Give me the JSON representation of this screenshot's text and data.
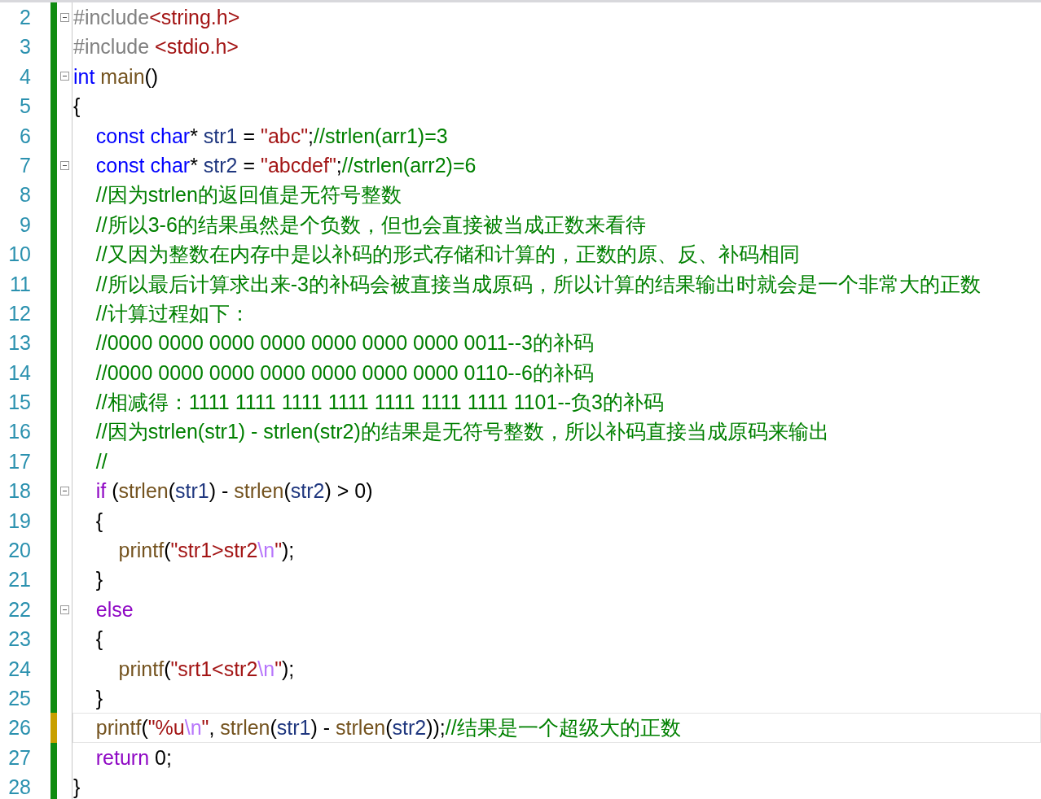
{
  "editor": {
    "lines": [
      {
        "number": "2",
        "modified": false,
        "fold_marker": true,
        "current": false,
        "tokens": [
          {
            "kind": "preproc",
            "text": "#include"
          },
          {
            "kind": "string",
            "text": "<string.h>"
          }
        ]
      },
      {
        "number": "3",
        "modified": false,
        "fold_marker": false,
        "current": false,
        "tokens": [
          {
            "kind": "preproc",
            "text": "#include"
          },
          {
            "kind": "string",
            "text": " <stdio.h>"
          }
        ]
      },
      {
        "number": "4",
        "modified": false,
        "fold_marker": true,
        "current": false,
        "tokens": [
          {
            "kind": "keyword",
            "text": "int"
          },
          {
            "kind": "function",
            "text": " main"
          },
          {
            "kind": "plain",
            "text": "()"
          }
        ]
      },
      {
        "number": "5",
        "modified": false,
        "fold_marker": false,
        "current": false,
        "tokens": [
          {
            "kind": "plain",
            "text": "{"
          }
        ]
      },
      {
        "number": "6",
        "modified": false,
        "fold_marker": false,
        "current": false,
        "tokens": [
          {
            "kind": "keyword",
            "text": "    const"
          },
          {
            "kind": "keyword",
            "text": " char"
          },
          {
            "kind": "plain",
            "text": "* "
          },
          {
            "kind": "variable",
            "text": "str1"
          },
          {
            "kind": "plain",
            "text": " = "
          },
          {
            "kind": "string",
            "text": "\"abc\""
          },
          {
            "kind": "plain",
            "text": ";"
          },
          {
            "kind": "comment",
            "text": "//strlen(arr1)=3"
          }
        ]
      },
      {
        "number": "7",
        "modified": false,
        "fold_marker": true,
        "current": false,
        "tokens": [
          {
            "kind": "keyword",
            "text": "    const"
          },
          {
            "kind": "keyword",
            "text": " char"
          },
          {
            "kind": "plain",
            "text": "* "
          },
          {
            "kind": "variable",
            "text": "str2"
          },
          {
            "kind": "plain",
            "text": " = "
          },
          {
            "kind": "string",
            "text": "\"abcdef\""
          },
          {
            "kind": "plain",
            "text": ";"
          },
          {
            "kind": "comment",
            "text": "//strlen(arr2)=6"
          }
        ]
      },
      {
        "number": "8",
        "modified": false,
        "fold_marker": false,
        "current": false,
        "tokens": [
          {
            "kind": "comment",
            "text": "    //因为strlen的返回值是无符号整数"
          }
        ]
      },
      {
        "number": "9",
        "modified": false,
        "fold_marker": false,
        "current": false,
        "tokens": [
          {
            "kind": "comment",
            "text": "    //所以3-6的结果虽然是个负数，但也会直接被当成正数来看待"
          }
        ]
      },
      {
        "number": "10",
        "modified": false,
        "fold_marker": false,
        "current": false,
        "tokens": [
          {
            "kind": "comment",
            "text": "    //又因为整数在内存中是以补码的形式存储和计算的，正数的原、反、补码相同"
          }
        ]
      },
      {
        "number": "11",
        "modified": false,
        "fold_marker": false,
        "current": false,
        "tokens": [
          {
            "kind": "comment",
            "text": "    //所以最后计算求出来-3的补码会被直接当成原码，所以计算的结果输出时就会是一个非常大的正数"
          }
        ]
      },
      {
        "number": "12",
        "modified": false,
        "fold_marker": false,
        "current": false,
        "tokens": [
          {
            "kind": "comment",
            "text": "    //计算过程如下："
          }
        ]
      },
      {
        "number": "13",
        "modified": false,
        "fold_marker": false,
        "current": false,
        "tokens": [
          {
            "kind": "comment",
            "text": "    //0000 0000 0000 0000 0000 0000 0000 0011--3的补码"
          }
        ]
      },
      {
        "number": "14",
        "modified": false,
        "fold_marker": false,
        "current": false,
        "tokens": [
          {
            "kind": "comment",
            "text": "    //0000 0000 0000 0000 0000 0000 0000 0110--6的补码"
          }
        ]
      },
      {
        "number": "15",
        "modified": false,
        "fold_marker": false,
        "current": false,
        "tokens": [
          {
            "kind": "comment",
            "text": "    //相减得：1111 1111 1111 1111 1111 1111 1111 1101--负3的补码"
          }
        ]
      },
      {
        "number": "16",
        "modified": false,
        "fold_marker": false,
        "current": false,
        "tokens": [
          {
            "kind": "comment",
            "text": "    //因为strlen(str1) - strlen(str2)的结果是无符号整数，所以补码直接当成原码来输出"
          }
        ]
      },
      {
        "number": "17",
        "modified": false,
        "fold_marker": false,
        "current": false,
        "tokens": [
          {
            "kind": "comment",
            "text": "    //"
          }
        ]
      },
      {
        "number": "18",
        "modified": false,
        "fold_marker": true,
        "current": false,
        "tokens": [
          {
            "kind": "control",
            "text": "    if"
          },
          {
            "kind": "plain",
            "text": " ("
          },
          {
            "kind": "function",
            "text": "strlen"
          },
          {
            "kind": "plain",
            "text": "("
          },
          {
            "kind": "variable",
            "text": "str1"
          },
          {
            "kind": "plain",
            "text": ") - "
          },
          {
            "kind": "function",
            "text": "strlen"
          },
          {
            "kind": "plain",
            "text": "("
          },
          {
            "kind": "variable",
            "text": "str2"
          },
          {
            "kind": "plain",
            "text": ") > 0)"
          }
        ]
      },
      {
        "number": "19",
        "modified": false,
        "fold_marker": false,
        "current": false,
        "tokens": [
          {
            "kind": "plain",
            "text": "    {"
          }
        ]
      },
      {
        "number": "20",
        "modified": false,
        "fold_marker": false,
        "current": false,
        "tokens": [
          {
            "kind": "function",
            "text": "        printf"
          },
          {
            "kind": "plain",
            "text": "("
          },
          {
            "kind": "string",
            "text": "\"str1>str2"
          },
          {
            "kind": "escape",
            "text": "\\n"
          },
          {
            "kind": "string",
            "text": "\""
          },
          {
            "kind": "plain",
            "text": ");"
          }
        ]
      },
      {
        "number": "21",
        "modified": false,
        "fold_marker": false,
        "current": false,
        "tokens": [
          {
            "kind": "plain",
            "text": "    }"
          }
        ]
      },
      {
        "number": "22",
        "modified": false,
        "fold_marker": true,
        "current": false,
        "tokens": [
          {
            "kind": "control",
            "text": "    else"
          }
        ]
      },
      {
        "number": "23",
        "modified": false,
        "fold_marker": false,
        "current": false,
        "tokens": [
          {
            "kind": "plain",
            "text": "    {"
          }
        ]
      },
      {
        "number": "24",
        "modified": false,
        "fold_marker": false,
        "current": false,
        "tokens": [
          {
            "kind": "function",
            "text": "        printf"
          },
          {
            "kind": "plain",
            "text": "("
          },
          {
            "kind": "string",
            "text": "\"srt1<str2"
          },
          {
            "kind": "escape",
            "text": "\\n"
          },
          {
            "kind": "string",
            "text": "\""
          },
          {
            "kind": "plain",
            "text": ");"
          }
        ]
      },
      {
        "number": "25",
        "modified": false,
        "fold_marker": false,
        "current": false,
        "tokens": [
          {
            "kind": "plain",
            "text": "    }"
          }
        ]
      },
      {
        "number": "26",
        "modified": true,
        "fold_marker": false,
        "current": true,
        "tokens": [
          {
            "kind": "function",
            "text": "    printf"
          },
          {
            "kind": "plain",
            "text": "("
          },
          {
            "kind": "string",
            "text": "\"%u"
          },
          {
            "kind": "escape",
            "text": "\\n"
          },
          {
            "kind": "string",
            "text": "\""
          },
          {
            "kind": "plain",
            "text": ", "
          },
          {
            "kind": "function",
            "text": "strlen"
          },
          {
            "kind": "plain",
            "text": "("
          },
          {
            "kind": "variable",
            "text": "str1"
          },
          {
            "kind": "plain",
            "text": ") - "
          },
          {
            "kind": "function",
            "text": "strlen"
          },
          {
            "kind": "plain",
            "text": "("
          },
          {
            "kind": "variable",
            "text": "str2"
          },
          {
            "kind": "plain",
            "text": "));"
          },
          {
            "kind": "comment",
            "text": "//结果是一个超级大的正数"
          }
        ]
      },
      {
        "number": "27",
        "modified": false,
        "fold_marker": false,
        "current": false,
        "tokens": [
          {
            "kind": "control",
            "text": "    return"
          },
          {
            "kind": "plain",
            "text": " 0;"
          }
        ]
      },
      {
        "number": "28",
        "modified": false,
        "fold_marker": false,
        "current": false,
        "tokens": [
          {
            "kind": "plain",
            "text": "}"
          }
        ]
      }
    ]
  }
}
